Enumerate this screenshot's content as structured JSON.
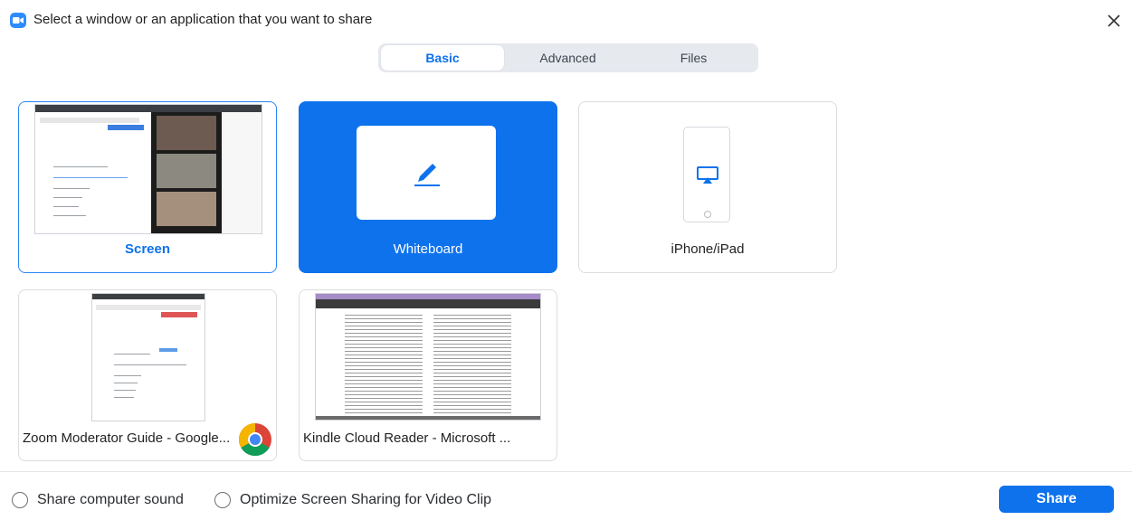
{
  "header": {
    "title": "Select a window or an application that you want to share"
  },
  "tabs": [
    {
      "label": "Basic",
      "active": true
    },
    {
      "label": "Advanced",
      "active": false
    },
    {
      "label": "Files",
      "active": false
    }
  ],
  "tiles": {
    "screen": {
      "label": "Screen",
      "selected": true
    },
    "whiteboard": {
      "label": "Whiteboard"
    },
    "iphone": {
      "label": "iPhone/iPad"
    },
    "chrome_window": {
      "label": "Zoom Moderator Guide - Google...",
      "app_icon": "chrome-icon"
    },
    "kindle_window": {
      "label": "Kindle Cloud Reader - Microsoft ..."
    }
  },
  "options": {
    "share_sound": {
      "label": "Share computer sound",
      "checked": false
    },
    "optimize_video": {
      "label": "Optimize Screen Sharing for Video Clip",
      "checked": false
    }
  },
  "footer": {
    "share_label": "Share"
  },
  "colors": {
    "accent": "#0e72ed",
    "brand": "#2D8CFF",
    "border": "#dcdde0"
  }
}
